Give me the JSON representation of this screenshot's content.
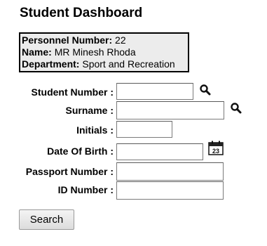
{
  "page": {
    "title": "Student Dashboard"
  },
  "personnel": {
    "number_label": "Personnel Number:",
    "number_value": "22",
    "name_label": "Name:",
    "name_value": "MR Minesh Rhoda",
    "department_label": "Department:",
    "department_value": "Sport and Recreation"
  },
  "form": {
    "student_number_label": "Student Number :",
    "surname_label": "Surname :",
    "initials_label": "Initials :",
    "dob_label": "Date Of Birth :",
    "passport_label": "Passport Number :",
    "id_label": "ID Number :",
    "student_number_value": "",
    "surname_value": "",
    "initials_value": "",
    "dob_value": "",
    "passport_value": "",
    "id_value": "",
    "calendar_day": "23"
  },
  "actions": {
    "search_label": "Search"
  },
  "icons": {
    "student_lookup": "search-icon",
    "surname_lookup": "search-icon",
    "dob_picker": "calendar-icon"
  }
}
